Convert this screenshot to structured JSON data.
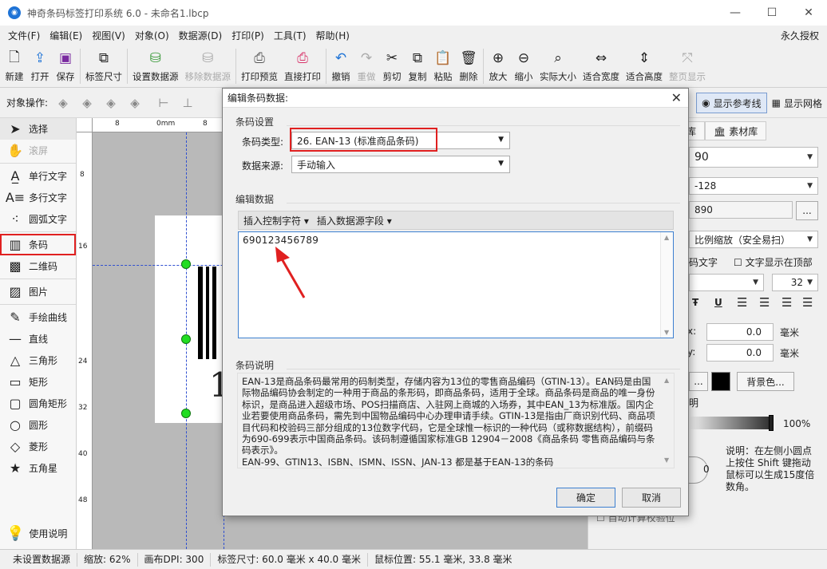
{
  "window": {
    "title": "神奇条码标签打印系统 6.0 - 未命名1.lbcp",
    "app_icon": "app-logo-icon"
  },
  "menu": {
    "items": [
      "文件(F)",
      "编辑(E)",
      "视图(V)",
      "对象(O)",
      "数据源(D)",
      "打印(P)",
      "工具(T)",
      "帮助(H)"
    ],
    "license": "永久授权"
  },
  "toolbar": {
    "new": "新建",
    "open": "打开",
    "save": "保存",
    "label_size": "标签尺寸",
    "set_datasource": "设置数据源",
    "remove_datasource": "移除数据源",
    "print_preview": "打印预览",
    "direct_print": "直接打印",
    "undo": "撤销",
    "redo": "重做",
    "cut": "剪切",
    "copy": "复制",
    "paste": "粘贴",
    "delete": "删除",
    "zoom_in": "放大",
    "zoom_out": "缩小",
    "actual_size": "实际大小",
    "fit_width": "适合宽度",
    "fit_height": "适合高度",
    "fit_page": "整页显示"
  },
  "opsbar": {
    "label": "对象操作:",
    "show_guides": "显示参考线",
    "show_grid": "显示网格"
  },
  "left_panel": {
    "select": "选择",
    "scroll": "滚屏",
    "single_text": "单行文字",
    "multi_text": "多行文字",
    "arc_text": "圆弧文字",
    "barcode": "条码",
    "qrcode": "二维码",
    "image": "图片",
    "freehand": "手绘曲线",
    "line": "直线",
    "triangle": "三角形",
    "rectangle": "矩形",
    "round_rect": "圆角矩形",
    "circle": "圆形",
    "diamond": "菱形",
    "star": "五角星",
    "help": "使用说明"
  },
  "rulers": {
    "h_marks": [
      "8",
      "0mm",
      "8"
    ],
    "v_marks": [
      "8",
      "16",
      "24",
      "32",
      "40",
      "48"
    ]
  },
  "canvas": {
    "barcode_digit": "1"
  },
  "right_panel": {
    "tab1": "库",
    "tab2": "素材库",
    "code_value": "90",
    "code_type": "-128",
    "data_value": "890",
    "more_btn": "...",
    "scale_mode": "比例缩放（安全易扫）",
    "show_text_label": "码文字",
    "text_top_label": "文字显示在顶部",
    "font_size": "32",
    "x_label": "x:",
    "y_label": "y:",
    "x_value": "0.0",
    "y_value": "0.0",
    "unit_mm": "毫米",
    "bg_color_btn": "背景色...",
    "ellipsis_btn": "...",
    "opacity_label": "明",
    "opacity_value": "100%",
    "angle_value": "0",
    "note": "说明：在左侧小圆点上按住 Shift 键拖动鼠标可以生成15度倍数角。",
    "checksum_label": "自动计算校验位"
  },
  "status": {
    "datasource": "未设置数据源",
    "zoom": "缩放: 62%",
    "dpi": "画布DPI: 300",
    "label_size": "标签尺寸: 60.0 毫米 x 40.0 毫米",
    "mouse_pos": "鼠标位置: 55.1 毫米, 33.8 毫米"
  },
  "dialog": {
    "title": "编辑条码数据:",
    "section_settings": "条码设置",
    "type_label": "条码类型:",
    "type_value": "26.  EAN-13 (标准商品条码)",
    "source_label": "数据来源:",
    "source_value": "手动输入",
    "section_edit": "编辑数据",
    "insert_control": "插入控制字符",
    "insert_field": "插入数据源字段",
    "data_value": "690123456789",
    "section_desc": "条码说明",
    "description": "EAN-13是商品条码最常用的码制类型，存储内容为13位的零售商品编码（GTIN-13）。EAN码是由国际物品编码协会制定的一种用于商品的条形码，即商品条码，适用于全球。商品条码是商品的唯一身份标识，是商品进入超级市场、POS扫描商店、入驻网上商城的入场券，其中EAN_13为标准版。国内企业若要使用商品条码，需先到中国物品编码中心办理申请手续。GTIN-13是指由厂商识别代码、商品项目代码和校验码三部分组成的13位数字代码，它是全球惟一标识的一种代码（或称数据结构），前缀码为690-699表示中国商品条码。该码制遵循国家标准GB 12904－2008《商品条码 零售商品编码与条码表示》。",
    "description2": "EAN-99、GTIN13、ISBN、ISMN、ISSN、JAN-13 都是基于EAN-13的条码",
    "ok": "确定",
    "cancel": "取消"
  }
}
